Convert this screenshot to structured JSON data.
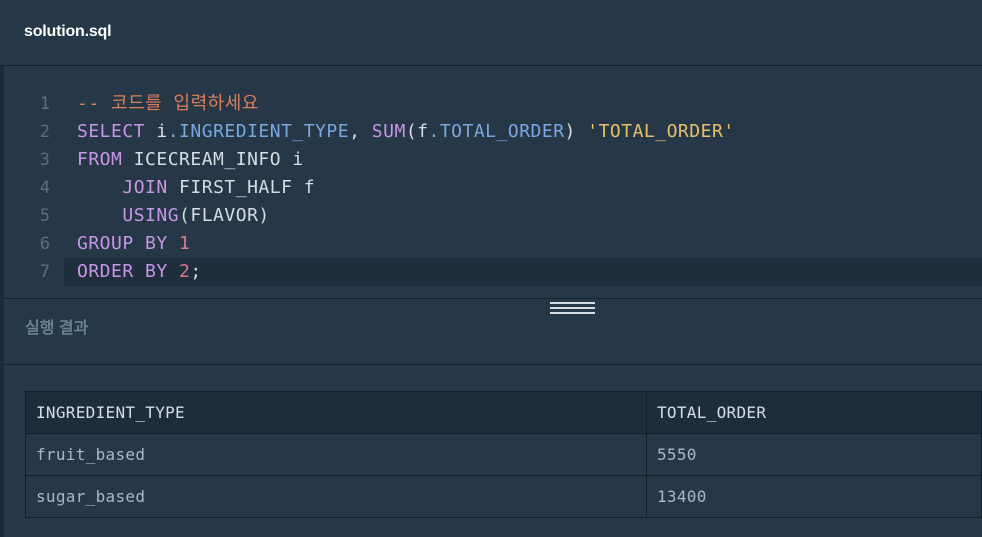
{
  "tab": {
    "title": "solution.sql"
  },
  "editor": {
    "lines": [
      {
        "number": "1",
        "tokens": [
          {
            "type": "comment",
            "text": "-- 코드를 입력하세요"
          }
        ]
      },
      {
        "number": "2",
        "tokens": [
          {
            "type": "kw",
            "text": "SELECT"
          },
          {
            "type": "plain",
            "text": " i"
          },
          {
            "type": "prop",
            "text": ".INGREDIENT_TYPE"
          },
          {
            "type": "plain",
            "text": ", "
          },
          {
            "type": "fn",
            "text": "SUM"
          },
          {
            "type": "plain",
            "text": "(f"
          },
          {
            "type": "prop",
            "text": ".TOTAL_ORDER"
          },
          {
            "type": "plain",
            "text": ") "
          },
          {
            "type": "str",
            "text": "'TOTAL_ORDER'"
          }
        ]
      },
      {
        "number": "3",
        "tokens": [
          {
            "type": "kw",
            "text": "FROM"
          },
          {
            "type": "plain",
            "text": " ICECREAM_INFO i"
          }
        ]
      },
      {
        "number": "4",
        "tokens": [
          {
            "type": "plain",
            "text": "    "
          },
          {
            "type": "kw",
            "text": "JOIN"
          },
          {
            "type": "plain",
            "text": " FIRST_HALF f"
          }
        ]
      },
      {
        "number": "5",
        "tokens": [
          {
            "type": "plain",
            "text": "    "
          },
          {
            "type": "fn",
            "text": "USING"
          },
          {
            "type": "plain",
            "text": "(FLAVOR)"
          }
        ]
      },
      {
        "number": "6",
        "tokens": [
          {
            "type": "kw",
            "text": "GROUP BY"
          },
          {
            "type": "plain",
            "text": " "
          },
          {
            "type": "num",
            "text": "1"
          }
        ]
      },
      {
        "number": "7",
        "tokens": [
          {
            "type": "kw",
            "text": "ORDER BY"
          },
          {
            "type": "plain",
            "text": " "
          },
          {
            "type": "num",
            "text": "2"
          },
          {
            "type": "plain",
            "text": ";"
          }
        ]
      }
    ],
    "active_line": 7
  },
  "result": {
    "title": "실행 결과",
    "columns": [
      "INGREDIENT_TYPE",
      "TOTAL_ORDER"
    ],
    "rows": [
      [
        "fruit_based",
        "5550"
      ],
      [
        "sugar_based",
        "13400"
      ]
    ]
  },
  "colors": {
    "background": "#263747",
    "comment": "#d9805a",
    "keyword": "#c896e6",
    "property": "#78a9e0",
    "string": "#e5c06a",
    "number": "#d97a8c"
  }
}
